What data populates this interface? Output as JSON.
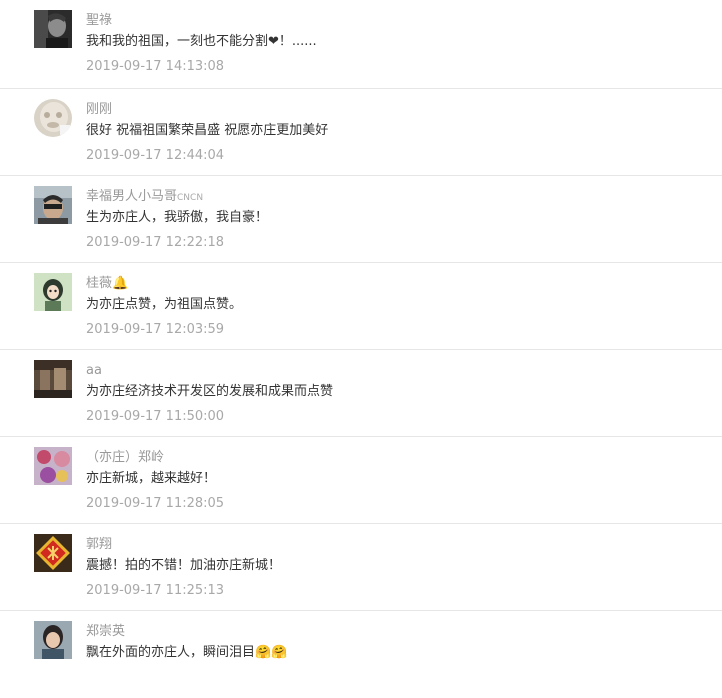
{
  "comments": [
    {
      "name": "聖祿",
      "text": "我和我的祖国，一刻也不能分割❤！......",
      "time": "2019-09-17 14:13:08",
      "avatar": "dark-portrait-avatar"
    },
    {
      "name": "刚刚",
      "text": "很好 祝福祖国繁荣昌盛 祝愿亦庄更加美好",
      "time": "2019-09-17 12:44:04",
      "avatar": "light-round-avatar"
    },
    {
      "name": "幸福男人小马哥",
      "name_suffix": "CNCN",
      "text": "生为亦庄人，我骄傲，我自豪！",
      "time": "2019-09-17 12:22:18",
      "avatar": "man-sunglasses-avatar"
    },
    {
      "name": "桂薇",
      "name_emoji": "🔔",
      "text": "为亦庄点赞，为祖国点赞。",
      "time": "2019-09-17 12:03:59",
      "avatar": "cartoon-girl-avatar"
    },
    {
      "name": "aa",
      "text": "为亦庄经济技术开发区的发展和成果而点赞",
      "time": "2019-09-17 11:50:00",
      "avatar": "street-scene-avatar"
    },
    {
      "name": "（亦庄）郑岭",
      "text": "亦庄新城，越来越好！",
      "time": "2019-09-17 11:28:05",
      "avatar": "flowers-avatar"
    },
    {
      "name": "郭翔",
      "text": "震撼！拍的不错！加油亦庄新城！",
      "time": "2019-09-17 11:25:13",
      "avatar": "fu-character-avatar"
    },
    {
      "name": "郑崇英",
      "text": "飘在外面的亦庄人，瞬间泪目🤗🤗",
      "time": "",
      "avatar": "woman-portrait-avatar"
    }
  ]
}
